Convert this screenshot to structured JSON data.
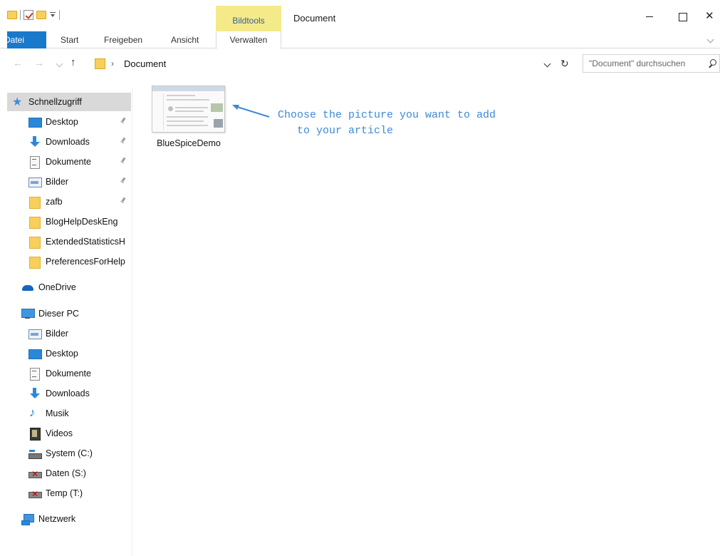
{
  "window": {
    "title": "Document",
    "context_tab_group": "Bildtools",
    "controls": {
      "close_glyph": "✕"
    }
  },
  "ribbon": {
    "tabs": [
      {
        "label": "Datei",
        "active": true
      },
      {
        "label": "Start"
      },
      {
        "label": "Freigeben"
      },
      {
        "label": "Ansicht"
      },
      {
        "label": "Verwalten"
      }
    ]
  },
  "address_bar": {
    "separator": "›",
    "path": "Document",
    "search_placeholder": "\"Document\" durchsuchen"
  },
  "navigation": {
    "items": [
      {
        "label": "Schnellzugriff",
        "icon": "star-icon",
        "selected": true
      },
      {
        "label": "Desktop",
        "icon": "desktop-icon",
        "pinned": true
      },
      {
        "label": "Downloads",
        "icon": "download-icon",
        "pinned": true
      },
      {
        "label": "Dokumente",
        "icon": "documents-icon",
        "pinned": true
      },
      {
        "label": "Bilder",
        "icon": "pictures-icon",
        "pinned": true
      },
      {
        "label": "zafb",
        "icon": "folder-icon",
        "pinned": true
      },
      {
        "label": "BlogHelpDeskEng",
        "icon": "folder-icon"
      },
      {
        "label": "ExtendedStatisticsH",
        "icon": "folder-icon"
      },
      {
        "label": "PreferencesForHelp",
        "icon": "folder-icon"
      },
      {
        "label": "OneDrive",
        "icon": "onedrive-icon"
      },
      {
        "label": "Dieser PC",
        "icon": "pc-icon"
      },
      {
        "label": "Bilder",
        "icon": "pictures-icon"
      },
      {
        "label": "Desktop",
        "icon": "desktop-icon"
      },
      {
        "label": "Dokumente",
        "icon": "documents-icon"
      },
      {
        "label": "Downloads",
        "icon": "download-icon"
      },
      {
        "label": "Musik",
        "icon": "music-icon"
      },
      {
        "label": "Videos",
        "icon": "videos-icon"
      },
      {
        "label": "System (C:)",
        "icon": "drive-icon"
      },
      {
        "label": "Daten (S:)",
        "icon": "network-drive-icon"
      },
      {
        "label": "Temp (T:)",
        "icon": "network-drive-icon"
      },
      {
        "label": "Netzwerk",
        "icon": "network-icon"
      }
    ]
  },
  "content": {
    "files": [
      {
        "name": "BlueSpiceDemo",
        "type": "image"
      }
    ],
    "annotation": {
      "line1": "Choose the picture you want to add",
      "line2": "   to your article",
      "color": "#3d8ad6"
    }
  },
  "colors": {
    "file_tab": "#1979ca",
    "context_tab": "#f4ea8a",
    "selection": "#d9d9d9"
  }
}
